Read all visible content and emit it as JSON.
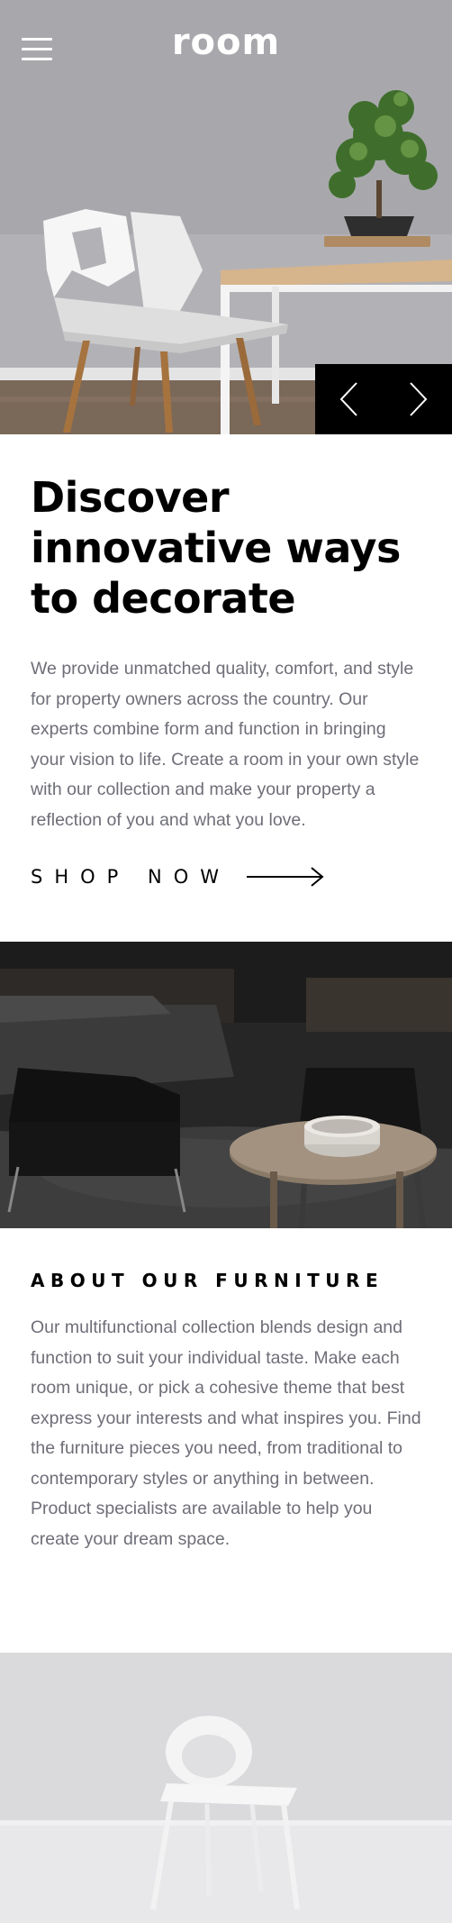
{
  "header": {
    "logo": "room",
    "menu_icon": "hamburger-menu-icon"
  },
  "hero": {
    "image": "white-chair-table-bonsai-photo",
    "prev_icon": "chevron-left-icon",
    "next_icon": "chevron-right-icon"
  },
  "intro": {
    "headline": "Discover innovative ways to decorate",
    "body": "We provide unmatched quality, comfort, and style for property owners across the country. Our experts combine form and function in bringing your vision to life. Create a room in your own style with our collection and make your property a reflection of you and what you love.",
    "cta_label": "SHOP NOW",
    "cta_icon": "long-arrow-right-icon"
  },
  "about": {
    "image": "dark-living-room-furniture-photo",
    "title": "ABOUT OUR FURNITURE",
    "body": "Our multifunctional collection blends design and function to suit your individual taste. Make each room unique, or pick a cohesive theme that best express your interests and what inspires you. Find the furniture pieces you need, from traditional to contemporary styles or anything in between. Product specialists are available to help you create your dream space."
  },
  "bottom": {
    "image": "light-white-chair-photo"
  },
  "colors": {
    "text_dark": "#000000",
    "text_body": "#6e6e78",
    "background": "#ffffff",
    "slider_bg": "#000000"
  }
}
